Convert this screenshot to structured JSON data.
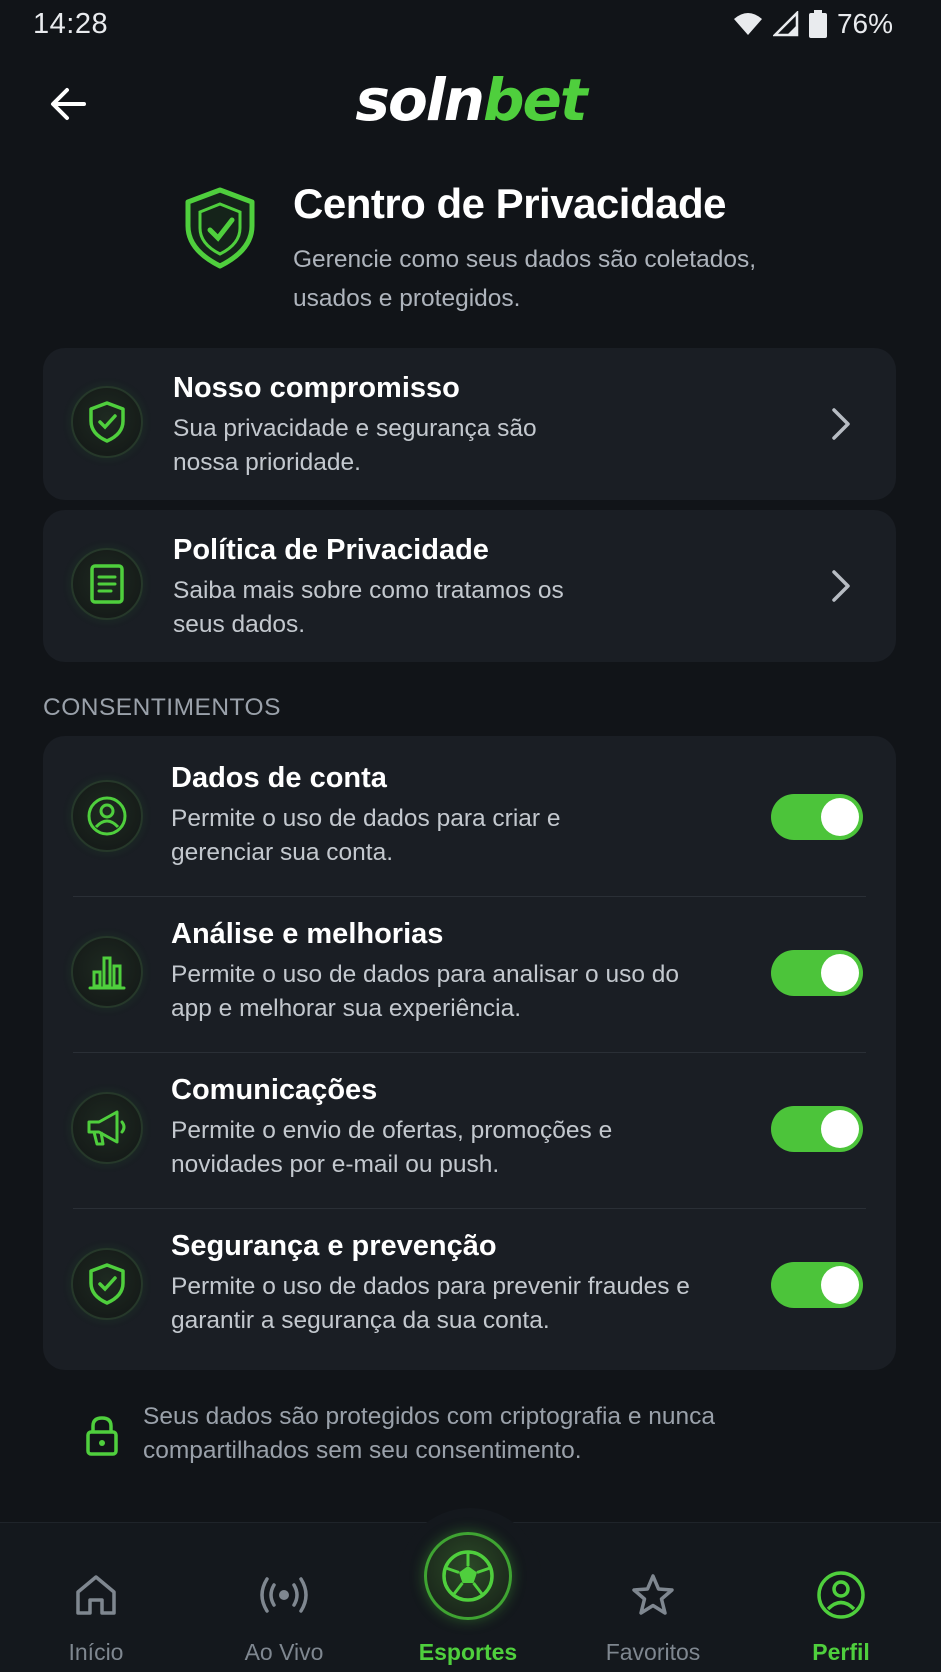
{
  "status_bar": {
    "time": "14:28",
    "battery_percent": "76%",
    "icons": [
      "wifi-icon",
      "signal-icon",
      "battery-icon"
    ]
  },
  "header": {
    "back_icon": "arrow-left-icon",
    "logo_part1": "soln",
    "logo_part2": "bet"
  },
  "hero": {
    "icon": "shield-icon",
    "title": "Centro de Privacidade",
    "subtitle": "Gerencie como seus dados são coletados, usados e protegidos."
  },
  "info_cards": [
    {
      "icon": "shield-check-icon",
      "title": "Nosso compromisso",
      "description": "Sua privacidade e segurança são nossa prioridade."
    },
    {
      "icon": "document-icon",
      "title": "Política de Privacidade",
      "description": "Saiba mais sobre como tratamos os seus dados."
    }
  ],
  "consents": {
    "section_label": "CONSENTIMENTOS",
    "items": [
      {
        "icon": "user-icon",
        "title": "Dados de conta",
        "description": "Permite o uso de dados para criar e gerenciar sua conta.",
        "enabled": true
      },
      {
        "icon": "bar-chart-icon",
        "title": "Análise e melhorias",
        "description": "Permite o uso de dados para analisar o uso do app e melhorar sua experiência.",
        "enabled": true
      },
      {
        "icon": "megaphone-icon",
        "title": "Comunicações",
        "description": "Permite o envio de ofertas, promoções e novidades por e-mail ou push.",
        "enabled": true
      },
      {
        "icon": "shield-check-icon",
        "title": "Segurança e prevenção",
        "description": "Permite o uso de dados para prevenir fraudes e garantir a segurança da sua conta.",
        "enabled": true
      }
    ]
  },
  "footer_note": {
    "icon": "lock-icon",
    "text": "Seus dados são protegidos com criptografia e nunca compartilhados sem seu consentimento."
  },
  "bottom_nav": {
    "items": [
      {
        "label": "Início",
        "icon": "home-icon",
        "active": false
      },
      {
        "label": "Ao Vivo",
        "icon": "live-broadcast-icon",
        "active": false
      },
      {
        "label": "Esportes",
        "icon": "soccer-ball-icon",
        "active": true
      },
      {
        "label": "Favoritos",
        "icon": "star-icon",
        "active": false
      },
      {
        "label": "Perfil",
        "icon": "profile-icon",
        "active": true
      }
    ]
  },
  "colors": {
    "background": "#111418",
    "card": "#1a1e24",
    "accent_green": "#4fcf3d",
    "toggle_on": "#4cc43a"
  }
}
